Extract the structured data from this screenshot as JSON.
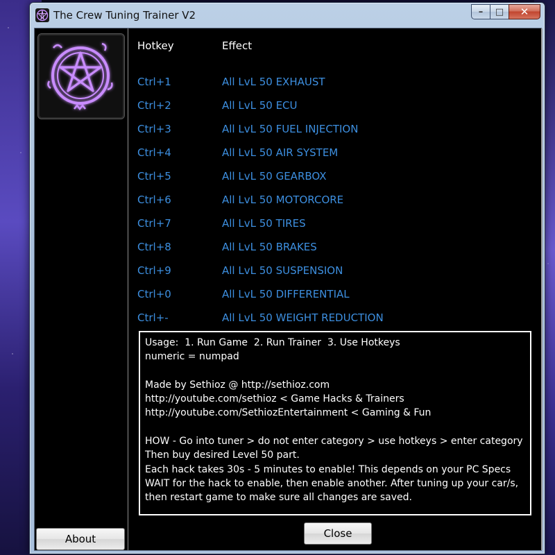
{
  "window": {
    "title": "The Crew Tuning Trainer V2",
    "controls": {
      "minimize": "–",
      "maximize": "□",
      "close": "✕"
    }
  },
  "table": {
    "headers": {
      "hotkey": "Hotkey",
      "effect": "Effect"
    },
    "rows": [
      {
        "hotkey": "Ctrl+1",
        "effect": "All LvL 50 EXHAUST"
      },
      {
        "hotkey": "Ctrl+2",
        "effect": "All LvL 50 ECU"
      },
      {
        "hotkey": "Ctrl+3",
        "effect": "All LvL 50 FUEL INJECTION"
      },
      {
        "hotkey": "Ctrl+4",
        "effect": "All LvL 50 AIR SYSTEM"
      },
      {
        "hotkey": "Ctrl+5",
        "effect": "All LvL 50 GEARBOX"
      },
      {
        "hotkey": "Ctrl+6",
        "effect": "All LvL 50 MOTORCORE"
      },
      {
        "hotkey": "Ctrl+7",
        "effect": "All LvL 50 TIRES"
      },
      {
        "hotkey": "Ctrl+8",
        "effect": "All LvL 50 BRAKES"
      },
      {
        "hotkey": "Ctrl+9",
        "effect": "All LvL 50 SUSPENSION"
      },
      {
        "hotkey": "Ctrl+0",
        "effect": "All LvL 50 DIFFERENTIAL"
      },
      {
        "hotkey": "Ctrl+-",
        "effect": "All LvL 50 WEIGHT REDUCTION"
      }
    ]
  },
  "info": {
    "text": "Usage:  1. Run Game  2. Run Trainer  3. Use Hotkeys\nnumeric = numpad\n\nMade by Sethioz @ http://sethioz.com\nhttp://youtube.com/sethioz < Game Hacks & Trainers\nhttp://youtube.com/SethiozEntertainment < Gaming & Fun\n\nHOW - Go into tuner > do not enter category > use hotkeys > enter category\nThen buy desired Level 50 part.\nEach hack takes 30s - 5 minutes to enable! This depends on your PC Specs\nWAIT for the hack to enable, then enable another. After tuning up your car/s,\nthen restart game to make sure all changes are saved."
  },
  "buttons": {
    "about": "About",
    "close": "Close"
  },
  "icons": {
    "app": "pentagram-icon",
    "logo": "pentagram-logo"
  },
  "colors": {
    "hotkey_text": "#3d8fe0",
    "logo_glow": "#b04dff"
  }
}
